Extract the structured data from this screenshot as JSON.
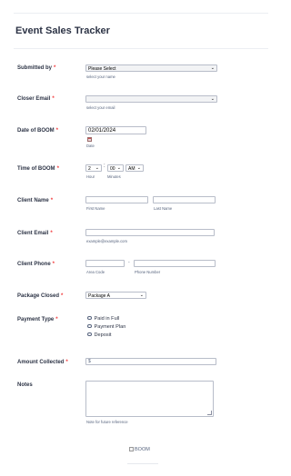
{
  "form": {
    "title": "Event Sales Tracker"
  },
  "submitted_by": {
    "label": "Submitted by",
    "required": "*",
    "selected": "Please Select",
    "sublabel": "select your name"
  },
  "closer_email": {
    "label": "Closer Email",
    "required": "*",
    "selected": "",
    "sublabel": "select your email"
  },
  "date_of_boom": {
    "label": "Date of BOOM",
    "required": "*",
    "value": "02/01/2024",
    "sublabel": "Date",
    "icon": "calendar-icon"
  },
  "time_of_boom": {
    "label": "Time of BOOM",
    "required": "*",
    "hour": "2",
    "minutes": "00",
    "ampm": "AM",
    "separator": ":",
    "hour_sublabel": "Hour",
    "minutes_sublabel": "Minutes"
  },
  "client_name": {
    "label": "Client Name",
    "required": "*",
    "first_sublabel": "First Name",
    "last_sublabel": "Last Name"
  },
  "client_email": {
    "label": "Client Email",
    "required": "*",
    "sublabel": "example@example.com"
  },
  "client_phone": {
    "label": "Client Phone",
    "required": "*",
    "separator": "-",
    "area_sublabel": "Area Code",
    "phone_sublabel": "Phone Number"
  },
  "package_closed": {
    "label": "Package Closed",
    "required": "*",
    "selected": "Package A"
  },
  "payment_type": {
    "label": "Payment Type",
    "required": "*",
    "options": [
      "Paid in Full",
      "Payment Plan",
      "Deposit"
    ]
  },
  "amount_collected": {
    "label": "Amount Collected",
    "required": "*",
    "prefix": "$"
  },
  "notes": {
    "label": "Notes",
    "sublabel": "Note for future reference"
  },
  "footer_image": {
    "alt": "BOOM"
  }
}
